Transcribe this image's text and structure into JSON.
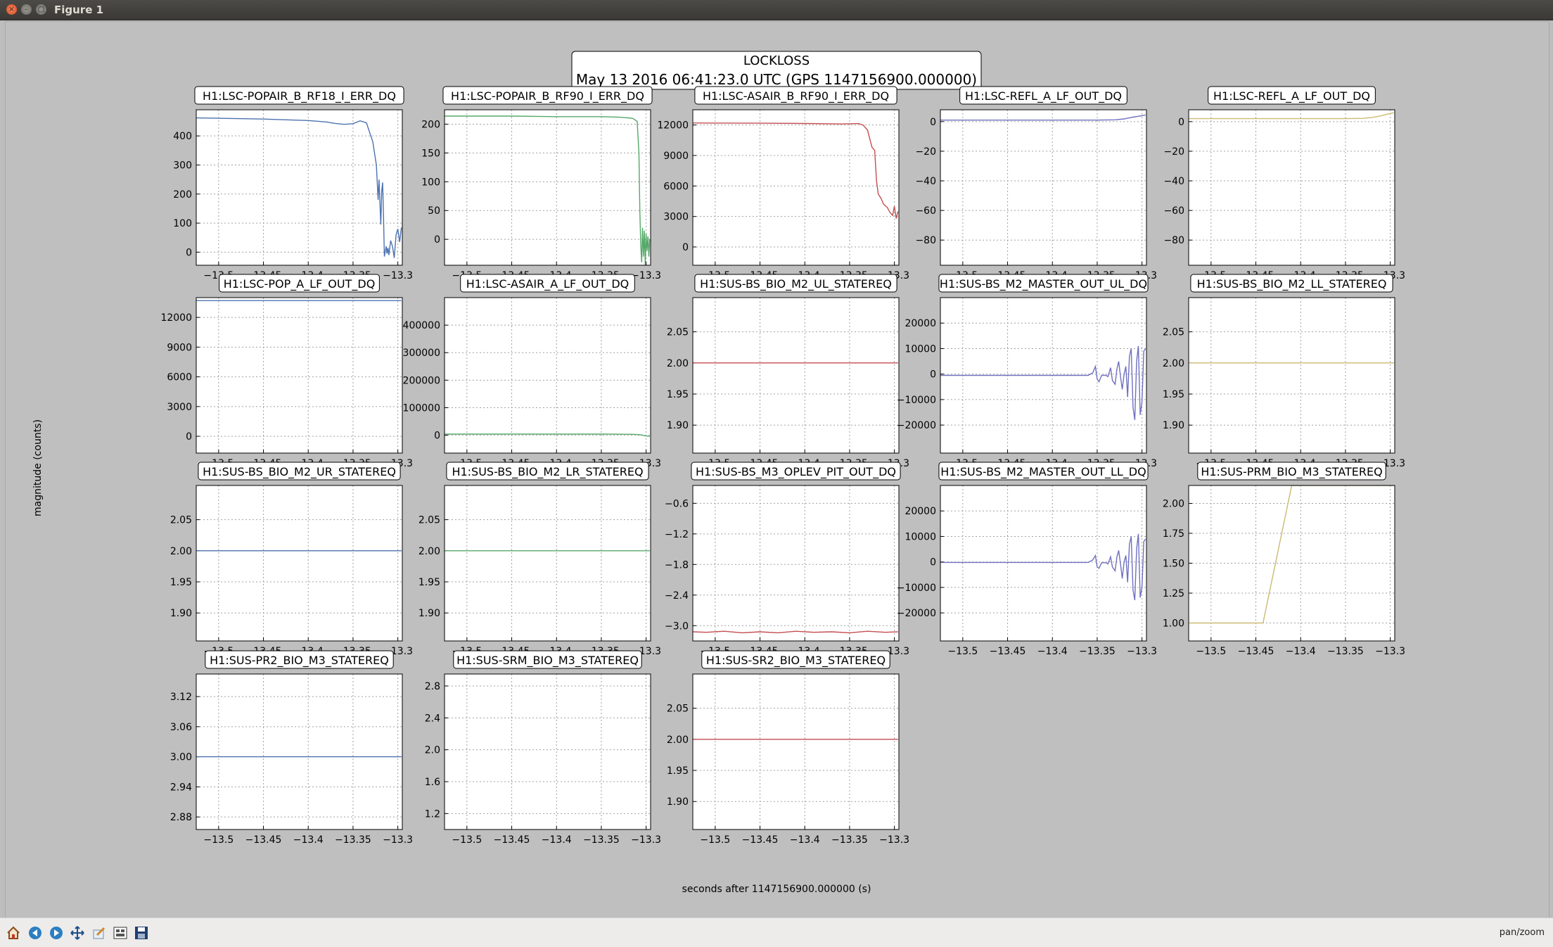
{
  "window": {
    "title": "Figure 1",
    "close_glyph": "×",
    "min_glyph": "–",
    "max_glyph": "□"
  },
  "toolbar": {
    "icons": [
      "home-icon",
      "back-arrow-icon",
      "forward-arrow-icon",
      "pan-icon",
      "zoom-icon",
      "subplots-icon",
      "save-icon"
    ],
    "status": "pan/zoom"
  },
  "chart_data": {
    "type": "line",
    "title": "LOCKLOSS",
    "subtitle": "May 13 2016 06:41:23.0 UTC (GPS 1147156900.000000)",
    "xlabel": "seconds after 1147156900.000000 (s)",
    "ylabel": "magnitude (counts)",
    "xlim": [
      -13.525,
      -13.295
    ],
    "xticks": [
      -13.5,
      -13.45,
      -13.4,
      -13.35,
      -13.3
    ],
    "xticklabels": [
      "−13.5",
      "−13.45",
      "−13.4",
      "−13.35",
      "−13.3"
    ],
    "grid": true,
    "panels": [
      {
        "title": "H1:LSC-POPAIR_B_RF18_I_ERR_DQ",
        "color": "#4c72b0",
        "ylim": [
          -45,
          490
        ],
        "yticks": [
          0,
          100,
          200,
          300,
          400
        ],
        "yticklabels": [
          "0",
          "100",
          "200",
          "300",
          "400"
        ],
        "x": [
          -13.525,
          -13.45,
          -13.4,
          -13.38,
          -13.37,
          -13.36,
          -13.35,
          -13.342,
          -13.335,
          -13.328,
          -13.324,
          -13.322,
          -13.321,
          -13.319,
          -13.318,
          -13.317,
          -13.316,
          -13.315,
          -13.313,
          -13.312,
          -13.311,
          -13.31,
          -13.308,
          -13.306,
          -13.304,
          -13.302,
          -13.3,
          -13.298,
          -13.296
        ],
        "y": [
          462,
          458,
          453,
          448,
          443,
          440,
          442,
          452,
          445,
          380,
          300,
          180,
          250,
          95,
          210,
          240,
          130,
          -15,
          20,
          -5,
          15,
          -10,
          40,
          20,
          -20,
          60,
          80,
          35,
          85
        ]
      },
      {
        "title": "H1:LSC-POPAIR_B_RF90_I_ERR_DQ",
        "color": "#55a868",
        "ylim": [
          -45,
          225
        ],
        "yticks": [
          0,
          50,
          100,
          150,
          200
        ],
        "yticklabels": [
          "0",
          "50",
          "100",
          "150",
          "200"
        ],
        "x": [
          -13.525,
          -13.45,
          -13.4,
          -13.35,
          -13.33,
          -13.32,
          -13.315,
          -13.31,
          -13.308,
          -13.307,
          -13.306,
          -13.305,
          -13.304,
          -13.303,
          -13.302,
          -13.301,
          -13.3,
          -13.299,
          -13.298,
          -13.297,
          -13.296
        ],
        "y": [
          214,
          214,
          213,
          213,
          212,
          211,
          210,
          205,
          150,
          50,
          -10,
          -40,
          20,
          -30,
          15,
          -45,
          10,
          -20,
          5,
          -30,
          0
        ]
      },
      {
        "title": "H1:LSC-ASAIR_B_RF90_I_ERR_DQ",
        "color": "#c44e52",
        "ylim": [
          -1800,
          13500
        ],
        "yticks": [
          0,
          3000,
          6000,
          9000,
          12000
        ],
        "yticklabels": [
          "0",
          "3000",
          "6000",
          "9000",
          "12000"
        ],
        "x": [
          -13.525,
          -13.45,
          -13.4,
          -13.36,
          -13.35,
          -13.34,
          -13.335,
          -13.33,
          -13.325,
          -13.322,
          -13.32,
          -13.318,
          -13.315,
          -13.312,
          -13.308,
          -13.305,
          -13.302,
          -13.3,
          -13.298,
          -13.296
        ],
        "y": [
          12200,
          12180,
          12150,
          12100,
          12120,
          12140,
          12000,
          11500,
          9800,
          9500,
          6500,
          5200,
          4800,
          4200,
          3900,
          3400,
          3100,
          4000,
          2800,
          3500
        ]
      },
      {
        "title": "H1:LSC-REFL_A_LF_OUT_DQ",
        "color": "#7070c0",
        "ylim": [
          -97,
          8
        ],
        "yticks": [
          0,
          -20,
          -40,
          -60,
          -80
        ],
        "yticklabels": [
          "0",
          "−20",
          "−40",
          "−60",
          "−80"
        ],
        "x": [
          -13.525,
          -13.4,
          -13.35,
          -13.33,
          -13.32,
          -13.31,
          -13.3,
          -13.296
        ],
        "y": [
          1,
          1,
          1,
          1.2,
          1.8,
          3,
          4,
          4.5
        ]
      },
      {
        "title": "H1:LSC-REFL_A_LF_OUT_DQ",
        "color": "#ccb974",
        "ylim": [
          -97,
          8
        ],
        "yticks": [
          0,
          -20,
          -40,
          -60,
          -80
        ],
        "yticklabels": [
          "0",
          "−20",
          "−40",
          "−60",
          "−80"
        ],
        "x": [
          -13.525,
          -13.4,
          -13.35,
          -13.33,
          -13.32,
          -13.31,
          -13.3,
          -13.296
        ],
        "y": [
          2,
          2,
          2,
          2.2,
          2.8,
          4,
          5.5,
          6
        ]
      },
      {
        "title": "H1:LSC-POP_A_LF_OUT_DQ",
        "color": "#4c72b0",
        "ylim": [
          -1700,
          14000
        ],
        "yticks": [
          0,
          3000,
          6000,
          9000,
          12000
        ],
        "yticklabels": [
          "0",
          "3000",
          "6000",
          "9000",
          "12000"
        ],
        "x": [
          -13.525,
          -13.45,
          -13.4,
          -13.35,
          -13.3,
          -13.296
        ],
        "y": [
          13700,
          13700,
          13700,
          13700,
          13700,
          13700
        ]
      },
      {
        "title": "H1:LSC-ASAIR_A_LF_OUT_DQ",
        "color": "#55a868",
        "ylim": [
          -65000,
          500000
        ],
        "yticks": [
          0,
          100000,
          200000,
          300000,
          400000
        ],
        "yticklabels": [
          "0",
          "100000",
          "200000",
          "300000",
          "400000"
        ],
        "x": [
          -13.525,
          -13.45,
          -13.4,
          -13.35,
          -13.32,
          -13.31,
          -13.305,
          -13.3,
          -13.296
        ],
        "y": [
          4000,
          4000,
          4000,
          4000,
          3500,
          2500,
          1000,
          -3000,
          -4000
        ]
      },
      {
        "title": "H1:SUS-BS_BIO_M2_UL_STATEREQ",
        "color": "#c44e52",
        "ylim": [
          1.855,
          2.105
        ],
        "yticks": [
          1.9,
          1.95,
          2.0,
          2.05
        ],
        "yticklabels": [
          "1.90",
          "1.95",
          "2.00",
          "2.05"
        ],
        "x": [
          -13.525,
          -13.296
        ],
        "y": [
          2.0,
          2.0
        ]
      },
      {
        "title": "H1:SUS-BS_M2_MASTER_OUT_UL_DQ",
        "color": "#7070c0",
        "ylim": [
          -31000,
          30000
        ],
        "yticks": [
          -20000,
          -10000,
          0,
          10000,
          20000
        ],
        "yticklabels": [
          "−20000",
          "−10000",
          "0",
          "10000",
          "20000"
        ],
        "x": [
          -13.525,
          -13.36,
          -13.355,
          -13.352,
          -13.35,
          -13.348,
          -13.345,
          -13.34,
          -13.338,
          -13.335,
          -13.333,
          -13.33,
          -13.328,
          -13.326,
          -13.324,
          -13.322,
          -13.32,
          -13.318,
          -13.316,
          -13.314,
          -13.312,
          -13.31,
          -13.308,
          -13.306,
          -13.304,
          -13.302,
          -13.3,
          -13.298,
          -13.296
        ],
        "y": [
          -500,
          -500,
          500,
          3000,
          -2000,
          -3000,
          -500,
          -500,
          -1000,
          2500,
          -2500,
          -4000,
          2000,
          5000,
          -1000,
          -6000,
          0,
          3000,
          -9000,
          7000,
          10000,
          -13000,
          -18000,
          5000,
          11000,
          -16000,
          -11000,
          9000,
          10000
        ]
      },
      {
        "title": "H1:SUS-BS_BIO_M2_LL_STATEREQ",
        "color": "#ccb974",
        "ylim": [
          1.855,
          2.105
        ],
        "yticks": [
          1.9,
          1.95,
          2.0,
          2.05
        ],
        "yticklabels": [
          "1.90",
          "1.95",
          "2.00",
          "2.05"
        ],
        "x": [
          -13.525,
          -13.296
        ],
        "y": [
          2.0,
          2.0
        ]
      },
      {
        "title": "H1:SUS-BS_BIO_M2_UR_STATEREQ",
        "color": "#4c72b0",
        "ylim": [
          1.855,
          2.105
        ],
        "yticks": [
          1.9,
          1.95,
          2.0,
          2.05
        ],
        "yticklabels": [
          "1.90",
          "1.95",
          "2.00",
          "2.05"
        ],
        "x": [
          -13.525,
          -13.296
        ],
        "y": [
          2.0,
          2.0
        ]
      },
      {
        "title": "H1:SUS-BS_BIO_M2_LR_STATEREQ",
        "color": "#55a868",
        "ylim": [
          1.855,
          2.105
        ],
        "yticks": [
          1.9,
          1.95,
          2.0,
          2.05
        ],
        "yticklabels": [
          "1.90",
          "1.95",
          "2.00",
          "2.05"
        ],
        "x": [
          -13.525,
          -13.296
        ],
        "y": [
          2.0,
          2.0
        ]
      },
      {
        "title": "H1:SUS-BS_M3_OPLEV_PIT_OUT_DQ",
        "color": "#c44e52",
        "ylim": [
          -3.3,
          -0.25
        ],
        "yticks": [
          -0.6,
          -1.2,
          -1.8,
          -2.4,
          -3.0
        ],
        "yticklabels": [
          "−0.6",
          "−1.2",
          "−1.8",
          "−2.4",
          "−3.0"
        ],
        "x": [
          -13.525,
          -13.51,
          -13.49,
          -13.47,
          -13.45,
          -13.43,
          -13.41,
          -13.39,
          -13.37,
          -13.35,
          -13.33,
          -13.31,
          -13.296
        ],
        "y": [
          -3.12,
          -3.13,
          -3.11,
          -3.14,
          -3.12,
          -3.14,
          -3.11,
          -3.13,
          -3.12,
          -3.14,
          -3.11,
          -3.13,
          -3.12
        ]
      },
      {
        "title": "H1:SUS-BS_M2_MASTER_OUT_LL_DQ",
        "color": "#7070c0",
        "ylim": [
          -31000,
          30000
        ],
        "yticks": [
          -20000,
          -10000,
          0,
          10000,
          20000
        ],
        "yticklabels": [
          "−20000",
          "−10000",
          "0",
          "10000",
          "20000"
        ],
        "x": [
          -13.525,
          -13.36,
          -13.355,
          -13.352,
          -13.35,
          -13.348,
          -13.345,
          -13.34,
          -13.338,
          -13.335,
          -13.333,
          -13.33,
          -13.328,
          -13.326,
          -13.324,
          -13.322,
          -13.32,
          -13.318,
          -13.316,
          -13.314,
          -13.312,
          -13.31,
          -13.308,
          -13.306,
          -13.304,
          -13.302,
          -13.3,
          -13.298,
          -13.296
        ],
        "y": [
          -200,
          -200,
          800,
          2500,
          -2000,
          -2500,
          -300,
          -300,
          -800,
          2000,
          -2000,
          -3500,
          2000,
          4500,
          -800,
          -6500,
          0,
          2500,
          -8000,
          7000,
          10000,
          -11000,
          -15000,
          5000,
          11000,
          -14000,
          -10000,
          8000,
          9000
        ]
      },
      {
        "title": "H1:SUS-PRM_BIO_M3_STATEREQ",
        "color": "#ccb974",
        "ylim": [
          0.85,
          2.15
        ],
        "yticks": [
          1.0,
          1.25,
          1.5,
          1.75,
          2.0
        ],
        "yticklabels": [
          "1.00",
          "1.25",
          "1.50",
          "1.75",
          "2.00"
        ],
        "x": [
          -13.525,
          -13.442,
          -13.41,
          -13.296
        ],
        "y": [
          1.0,
          1.0,
          2.15,
          2.15
        ]
      },
      {
        "title": "H1:SUS-PR2_BIO_M3_STATEREQ",
        "color": "#4c72b0",
        "ylim": [
          2.855,
          3.165
        ],
        "yticks": [
          2.88,
          2.94,
          3.0,
          3.06,
          3.12
        ],
        "yticklabels": [
          "2.88",
          "2.94",
          "3.00",
          "3.06",
          "3.12"
        ],
        "x": [
          -13.525,
          -13.296
        ],
        "y": [
          3.0,
          3.0
        ]
      },
      {
        "title": "H1:SUS-SRM_BIO_M3_STATEREQ",
        "color": "#55a868",
        "ylim": [
          1.0,
          2.95
        ],
        "yticks": [
          1.2,
          1.6,
          2.0,
          2.4,
          2.8
        ],
        "yticklabels": [
          "1.2",
          "1.6",
          "2.0",
          "2.4",
          "2.8"
        ],
        "x": [],
        "y": []
      },
      {
        "title": "H1:SUS-SR2_BIO_M3_STATEREQ",
        "color": "#c44e52",
        "ylim": [
          1.855,
          2.105
        ],
        "yticks": [
          1.9,
          1.95,
          2.0,
          2.05
        ],
        "yticklabels": [
          "1.90",
          "1.95",
          "2.00",
          "2.05"
        ],
        "x": [
          -13.525,
          -13.296
        ],
        "y": [
          2.0,
          2.0
        ]
      }
    ]
  }
}
